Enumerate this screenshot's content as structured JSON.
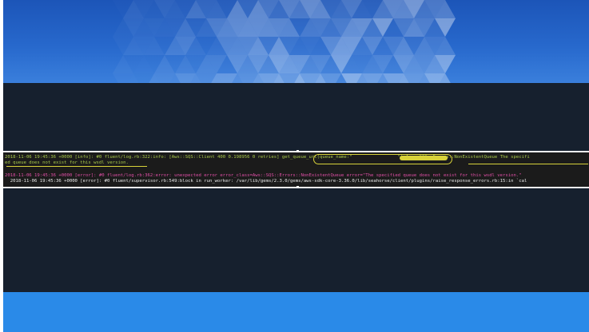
{
  "terminal": {
    "lines": [
      {
        "text": "2018-11-06 19:45:36 +0000 [info]: #0 fluent/log.rb:322:info: [Aws::SQS::Client 400 0.198956 0 retries] get_queue_url(queue_name:\"                 \") Aws::SQS::Errors::NonExistentQueue The specifi"
      },
      {
        "text": "ed queue does not exist for this wsdl version."
      },
      {
        "text": "2018-11-06 19:45:36 +0000 [error]: #0 fluent/log.rb:362:error: unexpected error error_class=Aws::SQS::Errors::NonExistentQueue error=\"The specified queue does not exist for this wsdl version.\""
      },
      {
        "text": "  2018-11-06 19:45:36 +0000 [error]: #0 fluent/supervisor.rb:549:block in run_worker: /var/lib/gems/2.3.0/gems/aws-sdk-core-3.36.0/lib/seahorse/client/plugins/raise_response_errors.rb:15:in `cal"
      }
    ]
  }
}
